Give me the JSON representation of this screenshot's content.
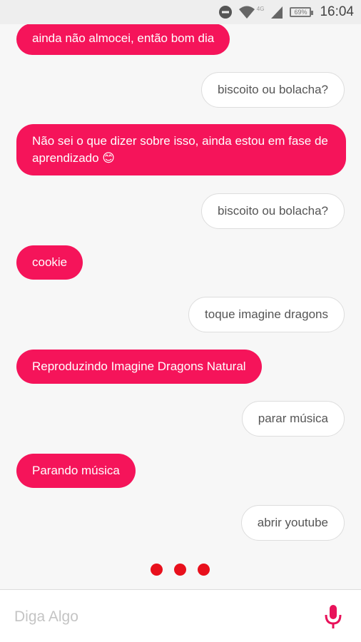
{
  "status_bar": {
    "network_label": "4G",
    "battery": "69%",
    "time": "16:04"
  },
  "colors": {
    "accent": "#f5145a",
    "typing_dot": "#e8101c"
  },
  "messages": [
    {
      "sender": "bot",
      "text": "ainda não almocei, então bom dia"
    },
    {
      "sender": "user",
      "text": "biscoito ou bolacha?"
    },
    {
      "sender": "bot",
      "text": "Não sei o que dizer sobre isso, ainda estou em fase de aprendizado 😊"
    },
    {
      "sender": "user",
      "text": "biscoito ou bolacha?"
    },
    {
      "sender": "bot",
      "text": "cookie"
    },
    {
      "sender": "user",
      "text": "toque imagine dragons"
    },
    {
      "sender": "bot",
      "text": "Reproduzindo Imagine Dragons Natural"
    },
    {
      "sender": "user",
      "text": "parar música"
    },
    {
      "sender": "bot",
      "text": "Parando música"
    },
    {
      "sender": "user",
      "text": "abrir youtube"
    }
  ],
  "input": {
    "placeholder": "Diga Algo",
    "value": ""
  }
}
